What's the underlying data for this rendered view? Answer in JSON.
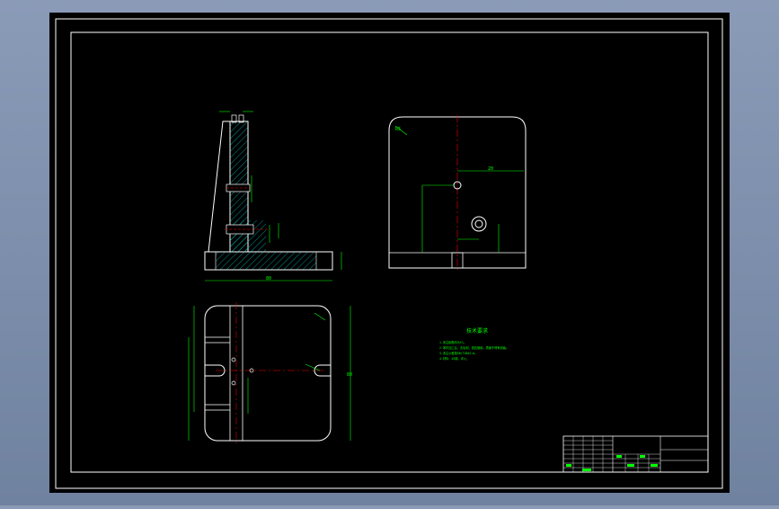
{
  "window": {
    "background_gradient": [
      "#8a9bb8",
      "#6f829f"
    ]
  },
  "drawing": {
    "sheet_color": "#000000",
    "frame_color": "#ffffff",
    "geometry_color": "#ffffff",
    "dimension_color": "#00ff00",
    "centerline_color": "#ff0000",
    "hatch_color": "#00c8c8",
    "tech_requirements_title": "技术要求",
    "tech_requirements": [
      "1.未注倒角均为C1。",
      "2.零件加工后，去毛刺，锐边倒钝，表面不得有划痕。",
      "3.未注公差按GB/T1804-m。",
      "4.材料：45钢，淬火。"
    ],
    "dimensions": {
      "top_view_width": "90",
      "top_view_height": "80",
      "side_view_base": "80",
      "hole_offset": "20",
      "radius_label": "R5"
    }
  }
}
